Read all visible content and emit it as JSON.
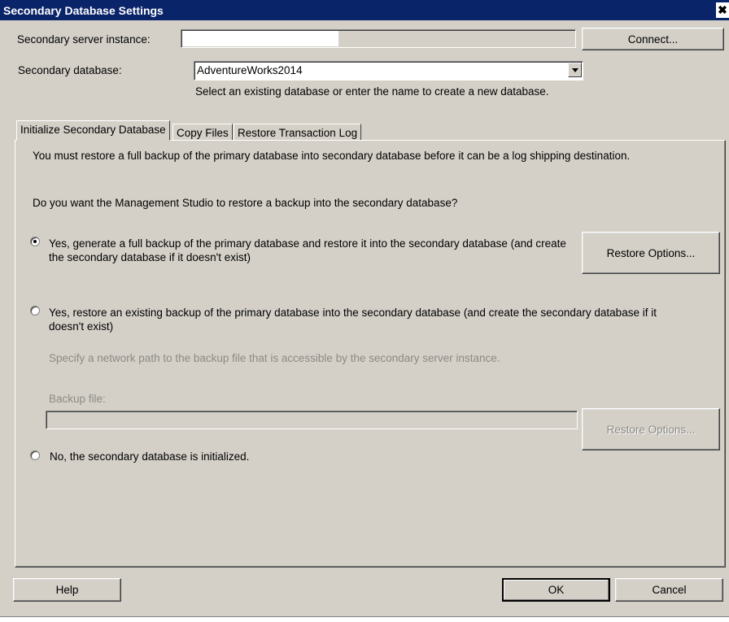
{
  "window": {
    "title": "Secondary Database Settings",
    "close_glyph": "✖"
  },
  "server": {
    "label": "Secondary server instance:",
    "value": "",
    "connect_label": "Connect..."
  },
  "database": {
    "label": "Secondary database:",
    "selected": "AdventureWorks2014",
    "hint": "Select an existing database or enter the name to create a new database."
  },
  "tabs": [
    {
      "label": "Initialize Secondary Database",
      "active": true
    },
    {
      "label": "Copy Files",
      "active": false
    },
    {
      "label": "Restore Transaction Log",
      "active": false
    }
  ],
  "init": {
    "intro": "You must restore a full backup of the primary database into secondary database before it can be a log shipping destination.",
    "question": "Do you want the Management Studio to restore a backup into the secondary database?",
    "option1": {
      "line1": "Yes, generate a full backup of the primary database and restore it into the secondary database (and create",
      "line2": "the secondary database if it doesn't exist)",
      "checked": true,
      "restore_options_label": "Restore Options..."
    },
    "option2": {
      "line1": "Yes, restore an existing backup of the primary database into the secondary database (and create the secondary database if it",
      "line2": "doesn't exist)",
      "checked": false,
      "path_hint": "Specify a network path to the backup file that is accessible by the secondary server instance.",
      "backup_file_label": "Backup file:",
      "backup_file_value": "",
      "restore_options_label": "Restore Options..."
    },
    "option3": {
      "label": "No, the secondary database is initialized.",
      "checked": false
    }
  },
  "footer": {
    "help_label": "Help",
    "ok_label": "OK",
    "cancel_label": "Cancel"
  }
}
